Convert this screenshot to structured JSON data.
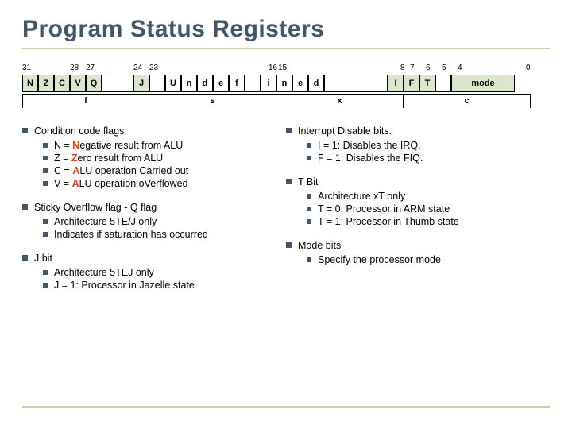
{
  "title": "Program Status Registers",
  "bit_positions": [
    "31",
    "28",
    "27",
    "24",
    "23",
    "16",
    "15",
    "8",
    "7",
    "6",
    "5",
    "4",
    "0"
  ],
  "reg_cells": {
    "c31": "N",
    "c30": "Z",
    "c29": "C",
    "c28": "V",
    "c27": "Q",
    "c24": "J",
    "u23": "U",
    "n22": "n",
    "d21": "d",
    "e20": "e",
    "f19": "f",
    "i18": "i",
    "n17": "n",
    "e16": "e",
    "d15": "d",
    "c7": "I",
    "c6": "F",
    "c5": "T",
    "mode": "mode"
  },
  "fields": {
    "f": "f",
    "s": "s",
    "x": "x",
    "c": "c"
  },
  "left": {
    "cond": {
      "title": "Condition code flags",
      "items": {
        "n": "egative result from ALU",
        "z": "ero result from ALU",
        "c": "arried out",
        "v": "erflowed"
      },
      "labels": {
        "n": "N = N",
        "z": "Z = Z",
        "c": "C = ALU operation C",
        "v": "V = ALU operation oV"
      }
    },
    "q": {
      "title": "Sticky Overflow flag - Q flag",
      "i1": "Architecture 5TE/J only",
      "i2": "Indicates if saturation has occurred"
    },
    "j": {
      "title": "J bit",
      "i1": "Architecture 5TEJ only",
      "i2": "J = 1: Processor in Jazelle state"
    }
  },
  "right": {
    "intd": {
      "title": "Interrupt Disable bits.",
      "i1": "I  = 1: Disables the IRQ.",
      "i2": "F = 1: Disables the FIQ."
    },
    "tbit": {
      "title": "T Bit",
      "i1": "Architecture xT only",
      "i2": "T = 0: Processor in ARM state",
      "i3": "T = 1: Processor in Thumb state"
    },
    "mode": {
      "title": "Mode bits",
      "i1": "Specify the processor mode"
    }
  },
  "chart_data": {
    "type": "table",
    "title": "Program Status Register bit layout",
    "bits": [
      {
        "bits": "31",
        "name": "N",
        "group": "f"
      },
      {
        "bits": "30",
        "name": "Z",
        "group": "f"
      },
      {
        "bits": "29",
        "name": "C",
        "group": "f"
      },
      {
        "bits": "28",
        "name": "V",
        "group": "f"
      },
      {
        "bits": "27",
        "name": "Q",
        "group": "f"
      },
      {
        "bits": "24",
        "name": "J",
        "group": "f"
      },
      {
        "bits": "23-16",
        "name": "Undef",
        "group": "s"
      },
      {
        "bits": "15-8",
        "name": "ined",
        "group": "x"
      },
      {
        "bits": "7",
        "name": "I",
        "group": "c"
      },
      {
        "bits": "6",
        "name": "F",
        "group": "c"
      },
      {
        "bits": "5",
        "name": "T",
        "group": "c"
      },
      {
        "bits": "4-0",
        "name": "mode",
        "group": "c"
      }
    ],
    "field_groups": [
      "f",
      "s",
      "x",
      "c"
    ]
  }
}
